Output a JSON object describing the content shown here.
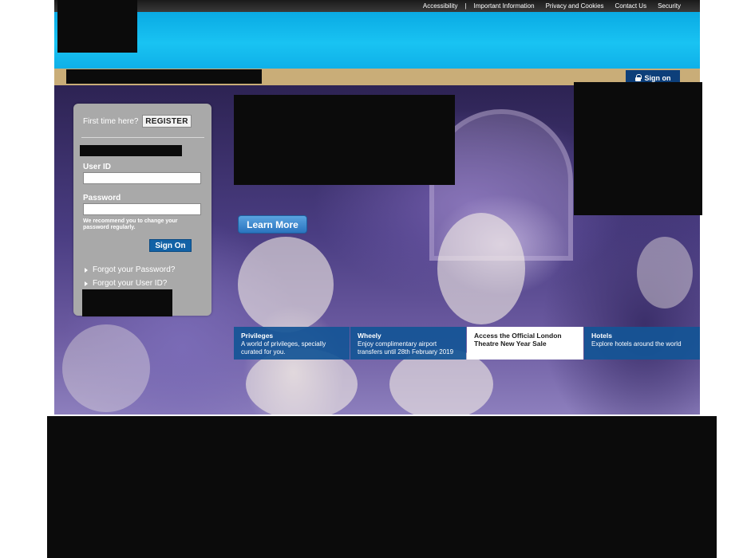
{
  "top_links": {
    "accessibility": "Accessibility",
    "important_information": "Important Information",
    "privacy_and_cookies": "Privacy and Cookies",
    "contact_us": "Contact Us",
    "security": "Security"
  },
  "nav": {
    "sign_on_tab": "Sign on"
  },
  "login": {
    "first_time": "First time here?",
    "register": "REGISTER",
    "user_id_label": "User ID",
    "user_id_value": "",
    "password_label": "Password",
    "password_value": "",
    "hint": "We recommend you to change your password regularly.",
    "sign_on_button": "Sign On",
    "forgot_password": "Forgot your Password?",
    "forgot_user_id": "Forgot your User ID?"
  },
  "hero": {
    "learn_more": "Learn More"
  },
  "promos": [
    {
      "title": "Privileges",
      "text": "A world of privileges, specially curated for you."
    },
    {
      "title": "Wheely",
      "text": "Enjoy complimentary airport transfers until 28th February 2019"
    },
    {
      "title": "Access the Official London Theatre New Year Sale",
      "text": ""
    },
    {
      "title": "Hotels",
      "text": "Explore hotels around the world"
    }
  ],
  "colors": {
    "header_blue": "#19c3f2",
    "nav_tan": "#c9ad78",
    "sign_on_navy": "#0d3f7a",
    "button_blue": "#1262a6",
    "promo_blue": "#145596"
  }
}
